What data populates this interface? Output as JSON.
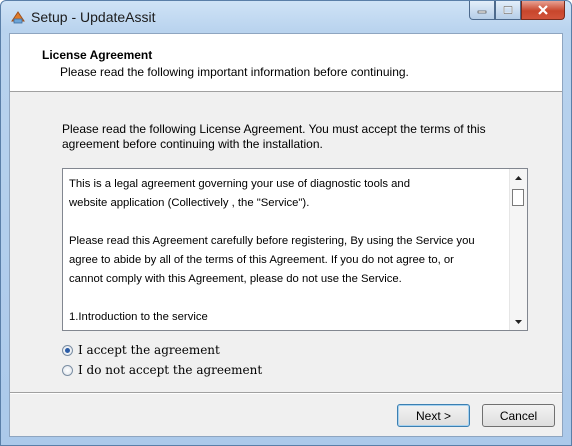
{
  "window": {
    "title": "Setup - UpdateAssit"
  },
  "header": {
    "title": "License Agreement",
    "subtitle": "Please read the following important information before continuing."
  },
  "intro": {
    "line1": "Please read the following License Agreement. You must accept the terms of this",
    "line2": "agreement before continuing with the installation."
  },
  "license": {
    "lines": [
      "This is a legal agreement governing your use of  diagnostic tools and",
      "website application (Collectively , the \"Service\").",
      "Please read this Agreement carefully before registering, By using the Service you",
      "agree to abide by all of the terms of this Agreement. If you do not agree to, or",
      "cannot comply with this Agreement, please do not use the Service.",
      "1.Introduction to the service"
    ]
  },
  "options": {
    "accept": "I accept the agreement",
    "decline": "I do not accept the agreement",
    "selected": "accept"
  },
  "buttons": {
    "next": "Next >",
    "cancel": "Cancel"
  },
  "icons": {
    "app": "setup-app-icon",
    "minimize": "minimize-icon",
    "maximize": "maximize-icon",
    "close": "close-icon"
  },
  "colors": {
    "accent": "#2a5ba6",
    "close_button": "#c8462c"
  }
}
